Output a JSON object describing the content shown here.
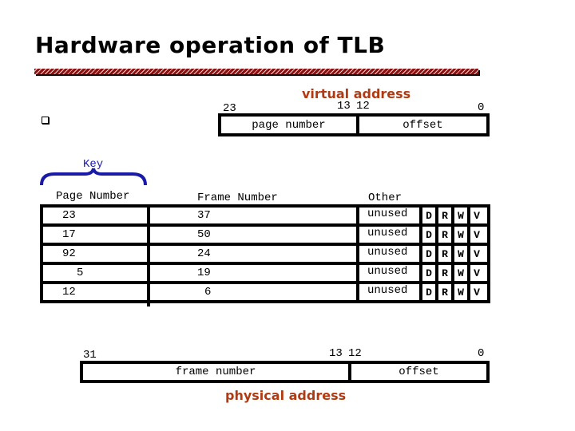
{
  "title": "Hardware operation of TLB",
  "virtual_address": {
    "label": "virtual address",
    "bits": {
      "high": "23",
      "split_high": "13",
      "split_low": "12",
      "low": "0"
    },
    "fields": [
      "page number",
      "offset"
    ]
  },
  "key": {
    "label": "Key"
  },
  "tlb_table": {
    "headers": {
      "page": "Page Number",
      "frame": "Frame Number",
      "other": "Other"
    },
    "rows": [
      {
        "page": "23",
        "frame": "37",
        "other": "unused",
        "flags": [
          "D",
          "R",
          "W",
          "V"
        ]
      },
      {
        "page": "17",
        "frame": "50",
        "other": "unused",
        "flags": [
          "D",
          "R",
          "W",
          "V"
        ]
      },
      {
        "page": "92",
        "frame": "24",
        "other": "unused",
        "flags": [
          "D",
          "R",
          "W",
          "V"
        ]
      },
      {
        "page": "5",
        "frame": "19",
        "other": "unused",
        "flags": [
          "D",
          "R",
          "W",
          "V"
        ]
      },
      {
        "page": "12",
        "frame": "6",
        "other": "unused",
        "flags": [
          "D",
          "R",
          "W",
          "V"
        ]
      }
    ]
  },
  "physical_address": {
    "label": "physical address",
    "bits": {
      "high": "31",
      "split_high": "13",
      "split_low": "12",
      "low": "0"
    },
    "fields": [
      "frame number",
      "offset"
    ]
  },
  "colors": {
    "label_red": "#b23a12",
    "key_blue": "#1a1aa8",
    "underline_red": "#8b1010"
  }
}
